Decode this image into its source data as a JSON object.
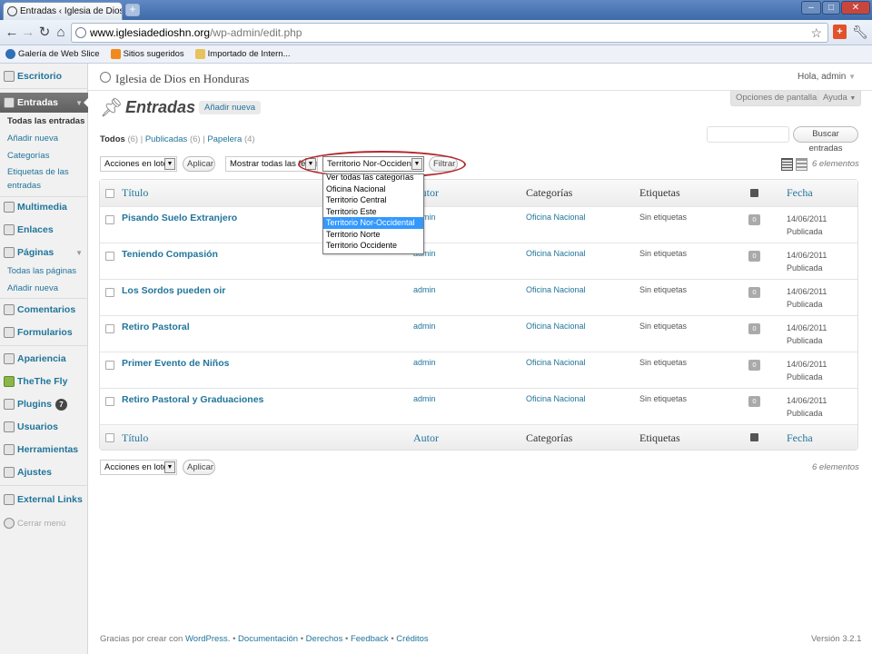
{
  "browser": {
    "tab_title": "Entradas ‹ Iglesia de Dios en",
    "tab_close": "×",
    "new_tab": "+",
    "url_host": "www.iglesiadedioshn.org",
    "url_path": "/wp-admin/edit.php",
    "bookmarks": [
      {
        "label": "Galería de Web Slice",
        "icon": "web-slice-icon",
        "color": "#2f6fb7"
      },
      {
        "label": "Sitios sugeridos",
        "icon": "suggested-sites-icon",
        "color": "#f08a1c"
      },
      {
        "label": "Importado de Intern...",
        "icon": "folder-icon",
        "color": "#e8c25a"
      }
    ]
  },
  "sidebar": {
    "items": [
      {
        "label": "Escritorio",
        "icon": "dashboard-icon"
      },
      {
        "label": "Entradas",
        "icon": "posts-icon"
      },
      {
        "label": "Multimedia",
        "icon": "media-icon"
      },
      {
        "label": "Enlaces",
        "icon": "links-icon"
      },
      {
        "label": "Páginas",
        "icon": "pages-icon"
      },
      {
        "label": "Comentarios",
        "icon": "comments-icon"
      },
      {
        "label": "Formularios",
        "icon": "forms-icon"
      },
      {
        "label": "Apariencia",
        "icon": "appearance-icon"
      },
      {
        "label": "TheThe Fly",
        "icon": "thethe-icon"
      },
      {
        "label": "Plugins",
        "icon": "plugins-icon",
        "badge": "7"
      },
      {
        "label": "Usuarios",
        "icon": "users-icon"
      },
      {
        "label": "Herramientas",
        "icon": "tools-icon"
      },
      {
        "label": "Ajustes",
        "icon": "settings-icon"
      },
      {
        "label": "External Links",
        "icon": "external-links-icon"
      }
    ],
    "posts_sub": [
      "Todas las entradas",
      "Añadir nueva",
      "Categorías",
      "Etiquetas de las",
      "entradas"
    ],
    "pages_sub": [
      "Todas las páginas",
      "Añadir nueva"
    ],
    "collapse": "Cerrar menú"
  },
  "header": {
    "site_title": "Iglesia de Dios en Honduras",
    "howdy": "Hola, admin",
    "screen_options": "Opciones de pantalla",
    "help": "Ayuda"
  },
  "page": {
    "title": "Entradas",
    "add_new": "Añadir nueva",
    "status": {
      "all": "Todos",
      "all_count": "(6)",
      "published": "Publicadas",
      "published_count": "(6)",
      "trash": "Papelera",
      "trash_count": "(4)"
    },
    "search_button": "Buscar entradas",
    "bulk_actions": "Acciones en lote",
    "apply": "Aplicar",
    "dates_filter": "Mostrar todas las fecha",
    "category_filter": "Territorio Nor-Occidental",
    "filter_button": "Filtrar",
    "count": "6 elementos"
  },
  "category_options": [
    "Ver todas las categorías",
    "Oficina Nacional",
    "Territorio Central",
    "Territorio Este",
    "Territorio Nor-Occidental",
    "Territorio Norte",
    "Territorio Occidente"
  ],
  "category_selected_index": 4,
  "columns": {
    "title": "Título",
    "author": "Autor",
    "categories": "Categorías",
    "tags": "Etiquetas",
    "date": "Fecha"
  },
  "posts": [
    {
      "title": "Pisando Suelo Extranjero",
      "author": "admin",
      "category": "Oficina Nacional",
      "tags": "Sin etiquetas",
      "comments": "0",
      "date": "14/06/2011",
      "status": "Publicada"
    },
    {
      "title": "Teniendo Compasión",
      "author": "admin",
      "category": "Oficina Nacional",
      "tags": "Sin etiquetas",
      "comments": "0",
      "date": "14/06/2011",
      "status": "Publicada"
    },
    {
      "title": "Los Sordos pueden oir",
      "author": "admin",
      "category": "Oficina Nacional",
      "tags": "Sin etiquetas",
      "comments": "0",
      "date": "14/06/2011",
      "status": "Publicada"
    },
    {
      "title": "Retiro Pastoral",
      "author": "admin",
      "category": "Oficina Nacional",
      "tags": "Sin etiquetas",
      "comments": "0",
      "date": "14/06/2011",
      "status": "Publicada"
    },
    {
      "title": "Primer Evento de Niños",
      "author": "admin",
      "category": "Oficina Nacional",
      "tags": "Sin etiquetas",
      "comments": "0",
      "date": "14/06/2011",
      "status": "Publicada"
    },
    {
      "title": "Retiro Pastoral y Graduaciones",
      "author": "admin",
      "category": "Oficina Nacional",
      "tags": "Sin etiquetas",
      "comments": "0",
      "date": "14/06/2011",
      "status": "Publicada"
    }
  ],
  "footer": {
    "prefix": "Gracias por crear con ",
    "wordpress": "WordPress.",
    "docs": "Documentación",
    "rights": "Derechos",
    "feedback": "Feedback",
    "credits": "Créditos",
    "separator": " • ",
    "version": "Versión 3.2.1"
  }
}
